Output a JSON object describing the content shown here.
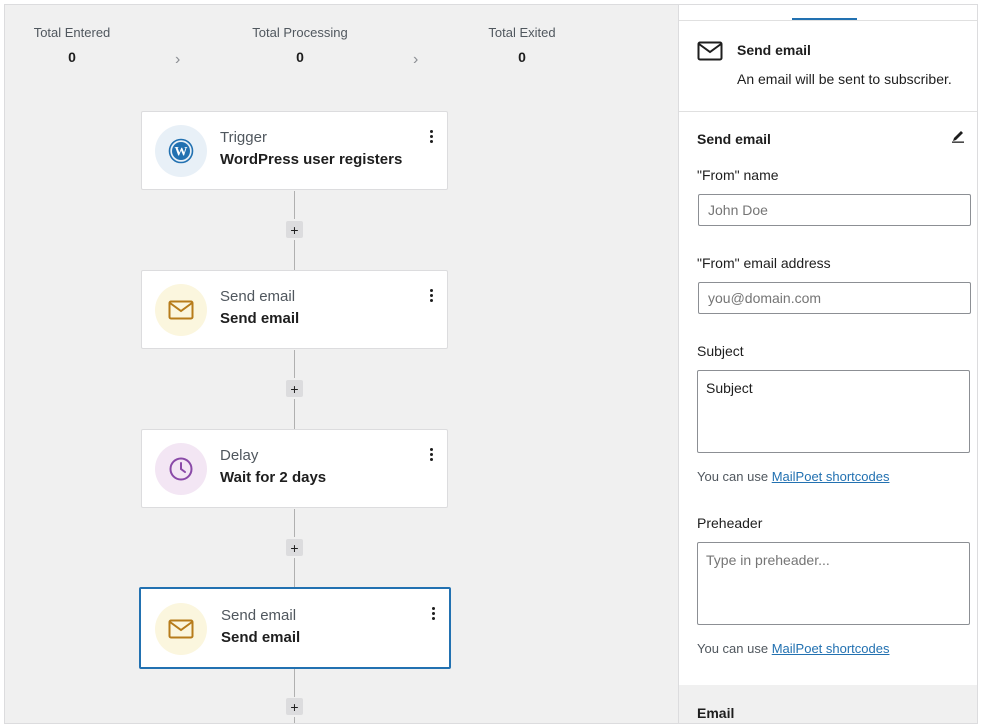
{
  "stats": [
    {
      "label": "Total Entered",
      "value": "0"
    },
    {
      "label": "Total Processing",
      "value": "0"
    },
    {
      "label": "Total Exited",
      "value": "0"
    }
  ],
  "steps": [
    {
      "subtitle": "Trigger",
      "title": "WordPress user registers",
      "icon": "wordpress-icon"
    },
    {
      "subtitle": "Send email",
      "title": "Send email",
      "icon": "envelope-icon"
    },
    {
      "subtitle": "Delay",
      "title": "Wait for 2 days",
      "icon": "clock-icon"
    },
    {
      "subtitle": "Send email",
      "title": "Send email",
      "icon": "envelope-icon",
      "selected": true
    }
  ],
  "add_step_symbol": "+",
  "sidebar": {
    "block_title": "Send email",
    "block_description": "An email will be sent to subscriber.",
    "panel_title": "Send email",
    "from_name": {
      "label": "\"From\" name",
      "placeholder": "John Doe",
      "value": ""
    },
    "from_email": {
      "label": "\"From\" email address",
      "placeholder": "you@domain.com",
      "value": ""
    },
    "subject": {
      "label": "Subject",
      "value": "Subject"
    },
    "preheader": {
      "label": "Preheader",
      "placeholder": "Type in preheader...",
      "value": ""
    },
    "help_prefix": "You can use ",
    "help_link": "MailPoet shortcodes",
    "email_section_title": "Email"
  },
  "colors": {
    "accent": "#2271b1",
    "canvas_bg": "#f0f0f0",
    "wp_icon": "#2271b1",
    "mail_icon": "#b77c1b",
    "clock_icon": "#8a4aa8"
  }
}
